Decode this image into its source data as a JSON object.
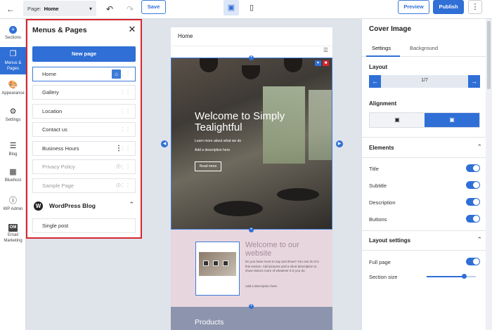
{
  "topbar": {
    "back_icon": "arrow-left-icon",
    "page_label": "Page:",
    "page_value": "Home",
    "save": "Save",
    "preview": "Preview",
    "publish": "Publish"
  },
  "rail": {
    "items": [
      {
        "label": "Sections"
      },
      {
        "label": "Menus &"
      },
      {
        "label": "Pages"
      },
      {
        "label": "Appearance"
      },
      {
        "label": "Settings"
      },
      {
        "label": "Blog"
      },
      {
        "label": "Bluehost"
      },
      {
        "label": "WP Admin"
      },
      {
        "label": "OM"
      },
      {
        "label": "Email"
      },
      {
        "label": "Marketing"
      }
    ]
  },
  "panel": {
    "title": "Menus & Pages",
    "new_page": "New page",
    "pages": [
      {
        "label": "Home"
      },
      {
        "label": "Gallery"
      },
      {
        "label": "Location"
      },
      {
        "label": "Contact us"
      },
      {
        "label": "Business Hours"
      },
      {
        "label": "Privacy Policy"
      },
      {
        "label": "Sample Page"
      }
    ],
    "wp_title": "WordPress Blog",
    "wp_items": [
      {
        "label": "Single post"
      }
    ]
  },
  "site": {
    "nav_home": "Home",
    "hero_title": "Welcome to Simply Tealightful",
    "hero_sub": "Learn more about what we do",
    "hero_desc": "Add a description here.",
    "hero_btn": "Read more",
    "sec2_title": "Welcome to our website",
    "sec2_body": "Do you have more to say and show? You can do it in this section. Add pictures and a short description to show visitors more of whatever it is you do.",
    "sec2_desc": "Add a description here.",
    "sec3_title": "Products"
  },
  "right": {
    "title": "Cover Image",
    "tab_settings": "Settings",
    "tab_background": "Background",
    "layout_label": "Layout",
    "layout_value": "1/7",
    "alignment_label": "Alignment",
    "elements_label": "Elements",
    "elements": [
      {
        "label": "Title",
        "on": true
      },
      {
        "label": "Subtitle",
        "on": true
      },
      {
        "label": "Description",
        "on": true
      },
      {
        "label": "Buttons",
        "on": true
      }
    ],
    "layout_settings_label": "Layout settings",
    "full_page": "Full page",
    "section_size": "Section size",
    "section_size_value": 0.75
  },
  "colors": {
    "accent": "#2f6fd6",
    "highlight": "#d7262e"
  }
}
